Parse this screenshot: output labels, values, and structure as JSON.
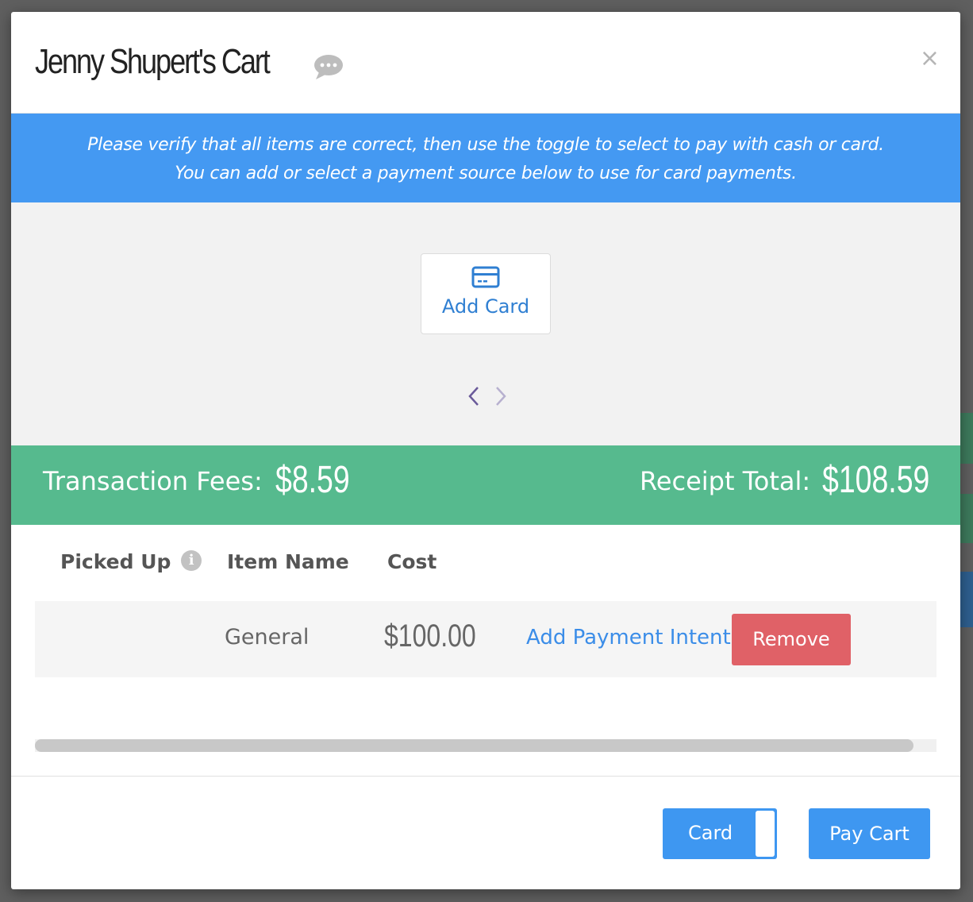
{
  "modal": {
    "title": "Jenny Shupert's Cart",
    "close_glyph": "×"
  },
  "banner": {
    "line1": "Please verify that all items are correct, then use the toggle to select to pay with cash or card.",
    "line2": "You can add or select a payment source below to use for card payments."
  },
  "payment_sources": {
    "add_card_label": "Add Card",
    "icon": "credit-card-icon"
  },
  "totals": {
    "fees_label": "Transaction Fees:",
    "fees_value": "$8.59",
    "total_label": "Receipt Total:",
    "total_value": "$108.59"
  },
  "table": {
    "headers": {
      "picked_up": "Picked Up",
      "item_name": "Item Name",
      "cost": "Cost"
    },
    "rows": [
      {
        "item_name": "General",
        "cost": "$100.00",
        "payment_intent_label": "Add Payment Intent",
        "remove_label": "Remove"
      }
    ]
  },
  "footer": {
    "toggle_label": "Card",
    "pay_label": "Pay Cart"
  },
  "colors": {
    "banner": "#4499f2",
    "totals_bar": "#56ba8e",
    "primary_button": "#3e97f1",
    "remove_button": "#e06167",
    "link": "#3b8de8"
  }
}
